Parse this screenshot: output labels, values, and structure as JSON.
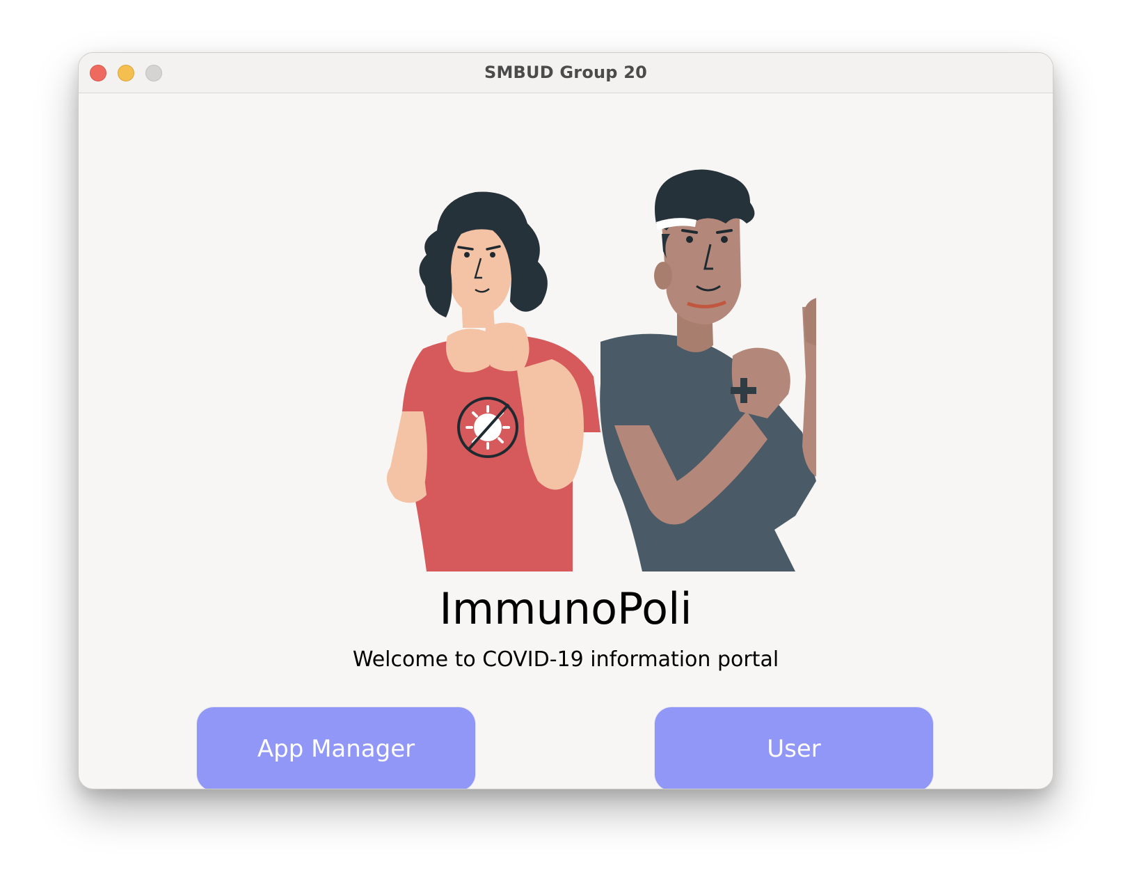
{
  "window": {
    "title": "SMBUD Group 20"
  },
  "main": {
    "app_name": "ImmunoPoli",
    "subtitle": "Welcome to COVID-19 information portal",
    "illustration": "two-people-fighting-virus-illustration"
  },
  "actions": {
    "app_manager_label": "App Manager",
    "user_label": "User"
  },
  "colors": {
    "window_bg": "#f8f6f4",
    "button_bg": "#9197f7",
    "button_text": "#ffffff",
    "close": "#ee6a5f",
    "minimize": "#f5bf4f",
    "zoom": "#d5d4d3"
  }
}
